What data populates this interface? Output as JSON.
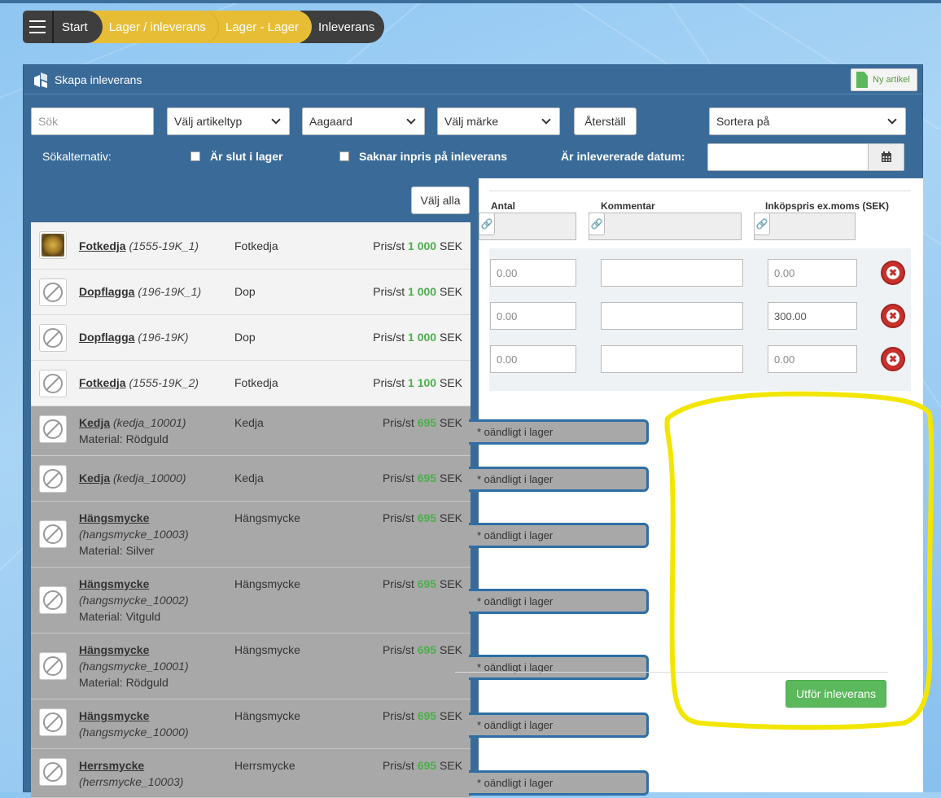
{
  "breadcrumb": [
    "Start",
    "Lager / inleverans",
    "Lager - Lager",
    "Inleverans"
  ],
  "panel": {
    "title": "Skapa inleverans",
    "new_article": "Ny artikel"
  },
  "filters": {
    "search_placeholder": "Sök",
    "article_type": "Välj artikeltyp",
    "supplier": "Aagaard",
    "brand": "Välj märke",
    "reset": "Återställ",
    "sort": "Sortera på"
  },
  "options": {
    "label": "Sökalternativ:",
    "out_of_stock": "Är slut i lager",
    "missing_price": "Saknar inpris på inleverans",
    "delivered_date": "Är inlevererade datum:"
  },
  "select_all": "Välj alla",
  "columns": {
    "quantity": "Antal",
    "comment": "Kommentar",
    "purchase_price": "Inköpspris ex.moms (SEK)"
  },
  "articles": [
    {
      "name": "Fotkedja",
      "code": "(1555-19K_1)",
      "material": "",
      "type": "Fotkedja",
      "price_label": "Pris/st",
      "price": "1 000",
      "currency": "SEK",
      "image": "photo"
    },
    {
      "name": "Dopflagga",
      "code": "(196-19K_1)",
      "material": "",
      "type": "Dop",
      "price_label": "Pris/st",
      "price": "1 000",
      "currency": "SEK",
      "image": "no-image-icon"
    },
    {
      "name": "Dopflagga",
      "code": "(196-19K)",
      "material": "",
      "type": "Dop",
      "price_label": "Pris/st",
      "price": "1 000",
      "currency": "SEK",
      "image": "no-image-icon"
    },
    {
      "name": "Fotkedja",
      "code": "(1555-19K_2)",
      "material": "",
      "type": "Fotkedja",
      "price_label": "Pris/st",
      "price": "1 100",
      "currency": "SEK",
      "image": "no-image-icon"
    },
    {
      "name": "Kedja",
      "code": "(kedja_10001)",
      "material": "Material: Rödguld",
      "type": "Kedja",
      "price_label": "Pris/st",
      "price": "695",
      "currency": "SEK",
      "image": "no-image-icon",
      "tab": "* oändligt i lager"
    },
    {
      "name": "Kedja",
      "code": "(kedja_10000)",
      "material": "",
      "type": "Kedja",
      "price_label": "Pris/st",
      "price": "695",
      "currency": "SEK",
      "image": "no-image-icon",
      "tab": "* oändligt i lager"
    },
    {
      "name": "Hängsmycke",
      "code": "(hangsmycke_10003)",
      "material": "Material: Silver",
      "type": "Hängsmycke",
      "price_label": "Pris/st",
      "price": "695",
      "currency": "SEK",
      "image": "no-image-icon",
      "tab": "* oändligt i lager"
    },
    {
      "name": "Hängsmycke",
      "code": "(hangsmycke_10002)",
      "material": "Material: Vitguld",
      "type": "Hängsmycke",
      "price_label": "Pris/st",
      "price": "695",
      "currency": "SEK",
      "image": "no-image-icon",
      "tab": "* oändligt i lager"
    },
    {
      "name": "Hängsmycke",
      "code": "(hangsmycke_10001)",
      "material": "Material: Rödguld",
      "type": "Hängsmycke",
      "price_label": "Pris/st",
      "price": "695",
      "currency": "SEK",
      "image": "no-image-icon",
      "tab": "* oändligt i lager"
    },
    {
      "name": "Hängsmycke",
      "code": "(hangsmycke_10000)",
      "material": "",
      "type": "Hängsmycke",
      "price_label": "Pris/st",
      "price": "695",
      "currency": "SEK",
      "image": "no-image-icon",
      "tab": "* oändligt i lager"
    },
    {
      "name": "Herrsmycke",
      "code": "(herrsmycke_10003)",
      "material": "",
      "type": "Herrsmycke",
      "price_label": "Pris/st",
      "price": "695",
      "currency": "SEK",
      "image": "no-image-icon",
      "tab": "* oändligt i lager"
    }
  ],
  "entries": [
    {
      "quantity_placeholder": "0.00",
      "comment": "",
      "price_placeholder": "0.00",
      "price_value": ""
    },
    {
      "quantity_placeholder": "0.00",
      "comment": "",
      "price_placeholder": "",
      "price_value": "300.00"
    },
    {
      "quantity_placeholder": "0.00",
      "comment": "",
      "price_placeholder": "0.00",
      "price_value": ""
    }
  ],
  "submit": "Utför inleverans",
  "colors": {
    "header_blue": "#3a6b98",
    "breadcrumb_gold": "#e8bd36",
    "breadcrumb_dark": "#3e3e3e",
    "price_green": "#4cae4c",
    "submit_green": "#5cb85c",
    "delete_red": "#c9302c",
    "highlight_yellow": "#f2e600"
  },
  "icons": [
    "menu-icon",
    "logo-icon",
    "document-icon",
    "chevron-down-icon",
    "calendar-icon",
    "link-icon",
    "no-image-icon",
    "delete-icon"
  ]
}
